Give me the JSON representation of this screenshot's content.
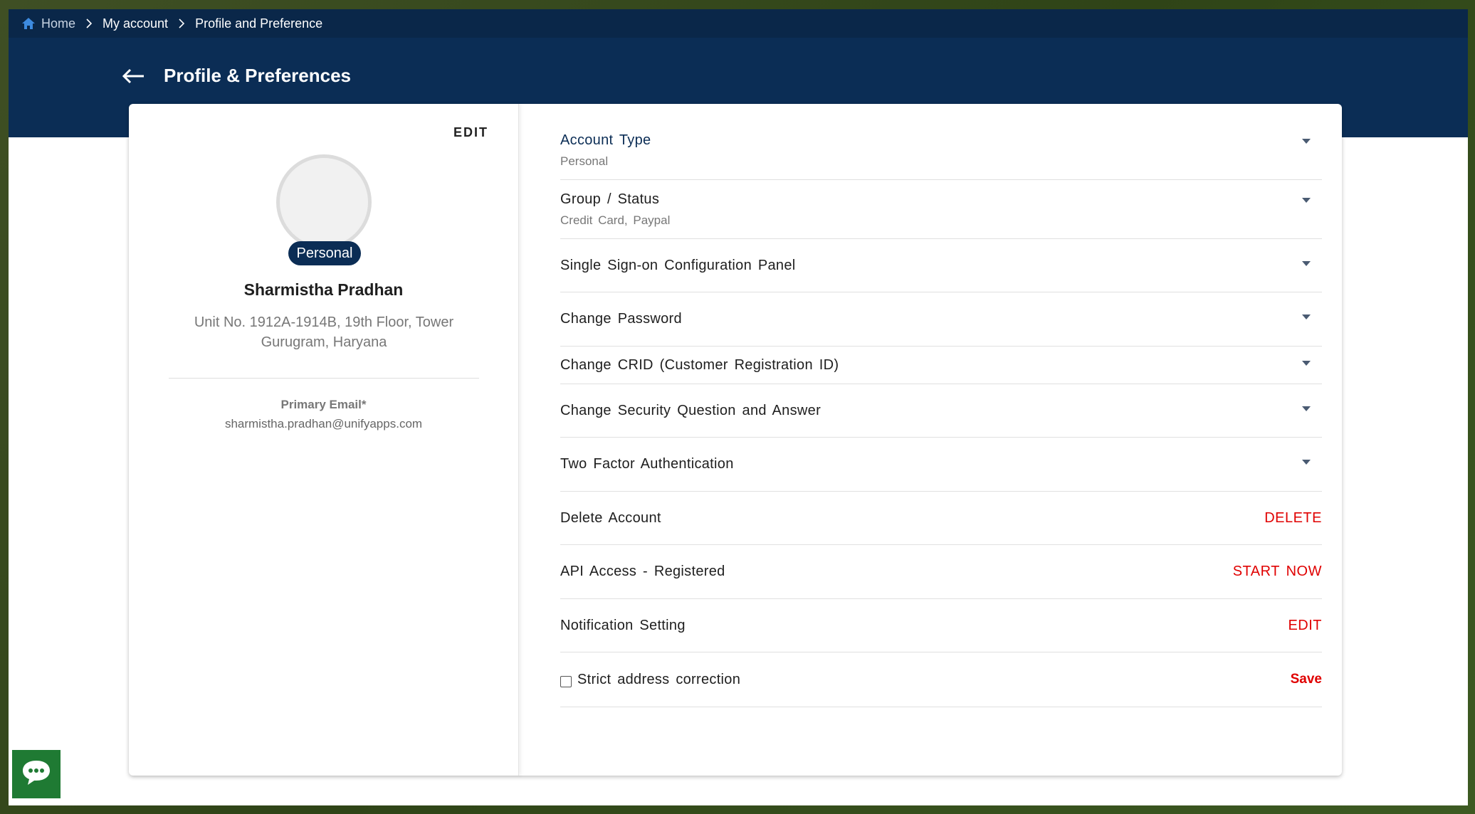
{
  "breadcrumb": {
    "home": "Home",
    "my_account": "My account",
    "current": "Profile and Preference"
  },
  "page": {
    "title": "Profile & Preferences"
  },
  "profile": {
    "edit_label": "EDIT",
    "badge": "Personal",
    "name": "Sharmistha Pradhan",
    "address_line1": "Unit No. 1912A-1914B, 19th Floor, Tower",
    "address_line2": "Gurugram, Haryana",
    "email_label": "Primary Email*",
    "email": "sharmistha.pradhan@unifyapps.com"
  },
  "settings": {
    "account_type": {
      "title": "Account Type",
      "value": "Personal"
    },
    "group_status": {
      "title": "Group / Status",
      "value": "Credit Card,  Paypal"
    },
    "sso": {
      "title": "Single Sign-on Configuration Panel"
    },
    "change_password": {
      "title": "Change Password"
    },
    "change_crid": {
      "title": "Change CRID (Customer Registration ID)"
    },
    "security_question": {
      "title": "Change Security Question and Answer"
    },
    "two_factor": {
      "title": "Two Factor Authentication"
    },
    "delete_account": {
      "title": "Delete Account",
      "action": "DELETE"
    },
    "api_access": {
      "title": "API Access - Registered",
      "action": "START NOW"
    },
    "notification": {
      "title": "Notification Setting",
      "action": "EDIT"
    },
    "strict_address": {
      "title": "Strict address correction",
      "action": "Save",
      "checked": false
    }
  },
  "colors": {
    "header_bg": "#0b2d55",
    "accent_red": "#e00000",
    "account_type_title": "#0b2d55",
    "chat_bg": "#1f7a33"
  },
  "icons": {
    "home": "home-icon",
    "breadcrumb_separator": "chevron-right-icon",
    "back": "arrow-left-icon",
    "dropdown": "caret-down-icon",
    "chat": "chat-bubble-icon"
  }
}
